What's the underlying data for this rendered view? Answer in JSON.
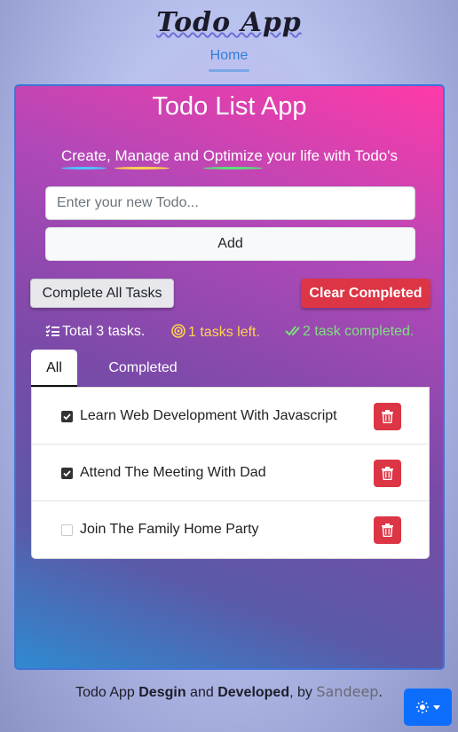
{
  "header": {
    "logo_text": "Todo App",
    "nav_home": "Home"
  },
  "card": {
    "title": "Todo List App",
    "tagline": {
      "word1": "Create",
      "sep1": ", ",
      "word2": "Manage",
      "sep2": " and ",
      "word3": "Optimize",
      "rest": " your life with Todo's"
    },
    "input_placeholder": "Enter your new Todo...",
    "add_label": "Add",
    "complete_all_label": "Complete All Tasks",
    "clear_completed_label": "Clear Completed",
    "stats": {
      "total": "Total 3 tasks.",
      "left": "1 tasks left.",
      "completed": "2 task completed."
    },
    "tabs": {
      "all": "All",
      "completed": "Completed"
    },
    "todos": [
      {
        "text": "Learn Web Development With Javascript",
        "checked": true
      },
      {
        "text": "Attend The Meeting With Dad",
        "checked": true
      },
      {
        "text": "Join The Family Home Party",
        "checked": false
      }
    ]
  },
  "footer": {
    "prefix": "Todo App ",
    "design": "Desgin",
    "and": " and ",
    "developed": "Developed",
    "by": ", by ",
    "author": "Sandeep",
    "end": "."
  },
  "colors": {
    "danger": "#dc3545",
    "primary": "#0d6efd",
    "stat_left": "#ffd34f",
    "stat_done": "#7ee07f"
  },
  "icons": {
    "stat_total": "list-check-icon",
    "stat_left": "target-icon",
    "stat_done": "double-check-icon",
    "delete": "trash-icon",
    "theme": "sun-icon"
  }
}
